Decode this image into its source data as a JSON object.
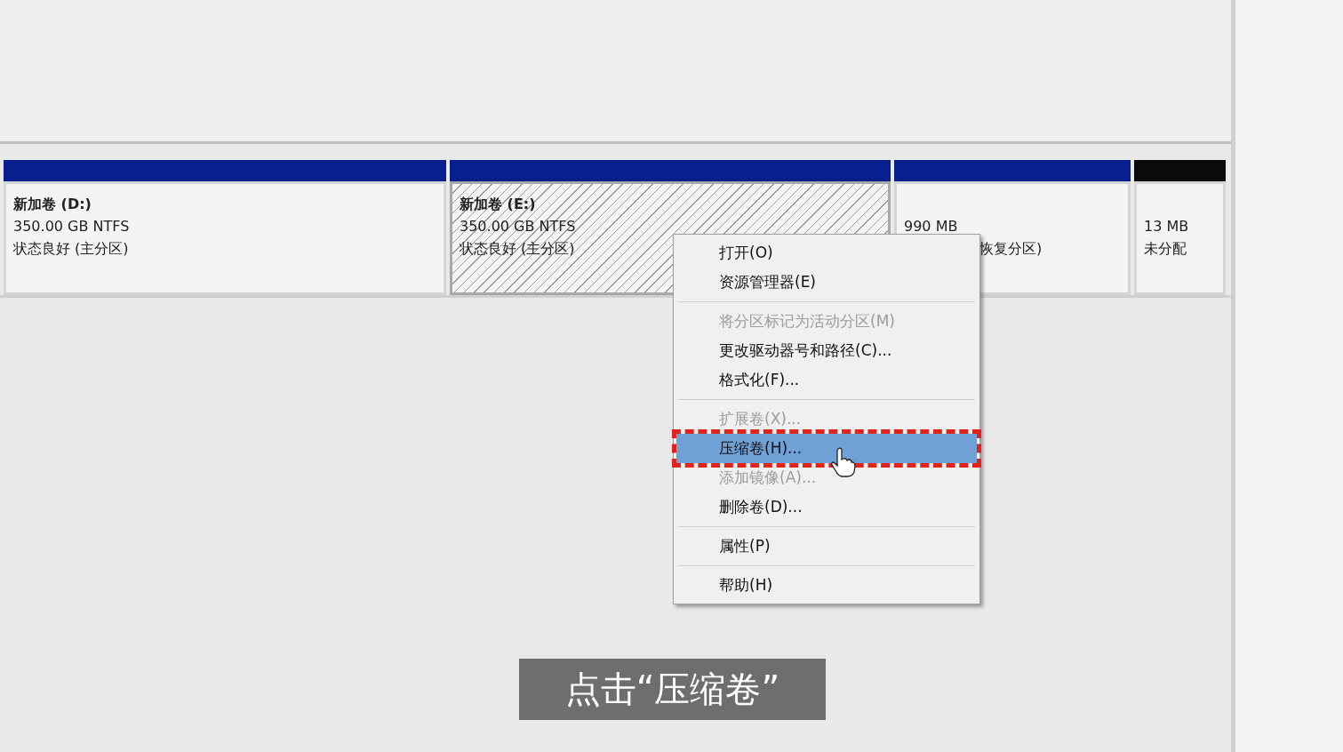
{
  "partitions": [
    {
      "color": "#0a1f8f",
      "selected": false,
      "title": "新加卷 (D:)",
      "lines": [
        "350.00 GB NTFS",
        "状态良好 (主分区)"
      ]
    },
    {
      "color": "#0a1f8f",
      "selected": true,
      "title": "新加卷 (E:)",
      "lines": [
        "350.00 GB NTFS",
        "状态良好 (主分区)"
      ]
    },
    {
      "color": "#0a1f8f",
      "selected": false,
      "lines": [
        "990 MB",
        "恢复分区)"
      ]
    },
    {
      "color": "#0a0a0a",
      "selected": false,
      "lines": [
        "13 MB",
        "未分配"
      ]
    }
  ],
  "context_menu": [
    {
      "kind": "item",
      "label": "打开(O)",
      "disabled": false,
      "selected": false
    },
    {
      "kind": "item",
      "label": "资源管理器(E)",
      "disabled": false,
      "selected": false
    },
    {
      "kind": "separator"
    },
    {
      "kind": "item",
      "label": "将分区标记为活动分区(M)",
      "disabled": true,
      "selected": false
    },
    {
      "kind": "item",
      "label": "更改驱动器号和路径(C)...",
      "disabled": false,
      "selected": false
    },
    {
      "kind": "item",
      "label": "格式化(F)...",
      "disabled": false,
      "selected": false
    },
    {
      "kind": "separator"
    },
    {
      "kind": "item",
      "label": "扩展卷(X)...",
      "disabled": true,
      "selected": false
    },
    {
      "kind": "item",
      "label": "压缩卷(H)...",
      "disabled": false,
      "selected": true
    },
    {
      "kind": "item",
      "label": "添加镜像(A)...",
      "disabled": true,
      "selected": false
    },
    {
      "kind": "item",
      "label": "删除卷(D)...",
      "disabled": false,
      "selected": false
    },
    {
      "kind": "separator"
    },
    {
      "kind": "item",
      "label": "属性(P)",
      "disabled": false,
      "selected": false
    },
    {
      "kind": "separator"
    },
    {
      "kind": "item",
      "label": "帮助(H)",
      "disabled": false,
      "selected": false
    }
  ],
  "caption": "点击“压缩卷”"
}
